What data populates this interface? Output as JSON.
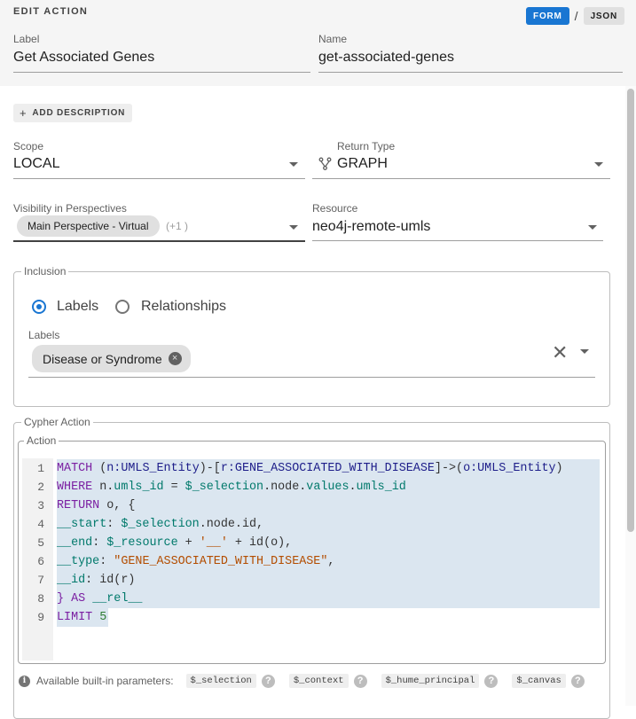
{
  "header": {
    "title": "EDIT ACTION",
    "mode_form": "FORM",
    "mode_sep": "/",
    "mode_json": "JSON"
  },
  "label_field": {
    "label": "Label",
    "value": "Get Associated Genes"
  },
  "name_field": {
    "label": "Name",
    "value": "get-associated-genes"
  },
  "add_description": {
    "plus": "+",
    "label": "ADD DESCRIPTION"
  },
  "scope": {
    "label": "Scope",
    "value": "LOCAL"
  },
  "return_type": {
    "label": "Return Type",
    "value": "GRAPH",
    "icon": "graph-branch-icon"
  },
  "visibility": {
    "label": "Visibility in Perspectives",
    "chip": "Main Perspective - Virtual",
    "more": "(+1 )"
  },
  "resource": {
    "label": "Resource",
    "value": "neo4j-remote-umls"
  },
  "inclusion": {
    "legend": "Inclusion",
    "radio_labels": "Labels",
    "radio_relationships": "Relationships",
    "selected": "Labels",
    "labels_field_label": "Labels",
    "labels_chip": "Disease or Syndrome",
    "chip_remove": "×",
    "clear": "✕"
  },
  "cypher": {
    "legend": "Cypher Action",
    "action_legend": "Action",
    "lines": [
      [
        {
          "c": "k",
          "t": "MATCH "
        },
        {
          "c": "p",
          "t": "("
        },
        {
          "c": "t",
          "t": "n:UMLS_Entity"
        },
        {
          "c": "p",
          "t": ")-["
        },
        {
          "c": "t",
          "t": "r:GENE_ASSOCIATED_WITH_DISEASE"
        },
        {
          "c": "p",
          "t": "]->("
        },
        {
          "c": "t",
          "t": "o:UMLS_Entity"
        },
        {
          "c": "p",
          "t": ")"
        }
      ],
      [
        {
          "c": "k",
          "t": "WHERE "
        },
        {
          "c": "p",
          "t": "n."
        },
        {
          "c": "v",
          "t": "umls_id"
        },
        {
          "c": "p",
          "t": " = "
        },
        {
          "c": "v",
          "t": "$_selection"
        },
        {
          "c": "p",
          "t": ".node."
        },
        {
          "c": "v",
          "t": "values"
        },
        {
          "c": "p",
          "t": "."
        },
        {
          "c": "v",
          "t": "umls_id"
        }
      ],
      [
        {
          "c": "k",
          "t": "RETURN "
        },
        {
          "c": "p",
          "t": "o, {"
        }
      ],
      [
        {
          "c": "v",
          "t": "__start"
        },
        {
          "c": "p",
          "t": ": "
        },
        {
          "c": "v",
          "t": "$_selection"
        },
        {
          "c": "p",
          "t": ".node.id,"
        }
      ],
      [
        {
          "c": "v",
          "t": "__end"
        },
        {
          "c": "p",
          "t": ": "
        },
        {
          "c": "v",
          "t": "$_resource"
        },
        {
          "c": "p",
          "t": " + "
        },
        {
          "c": "s",
          "t": "'__'"
        },
        {
          "c": "p",
          "t": " + id(o),"
        }
      ],
      [
        {
          "c": "v",
          "t": "__type"
        },
        {
          "c": "p",
          "t": ": "
        },
        {
          "c": "s",
          "t": "\"GENE_ASSOCIATED_WITH_DISEASE\""
        },
        {
          "c": "p",
          "t": ","
        }
      ],
      [
        {
          "c": "v",
          "t": "__id"
        },
        {
          "c": "p",
          "t": ": id(r)"
        }
      ],
      [
        {
          "c": "k",
          "t": "} AS "
        },
        {
          "c": "v",
          "t": "__rel__"
        }
      ],
      [
        {
          "c": "k",
          "t": "LIMIT "
        },
        {
          "c": "num",
          "t": "5"
        }
      ]
    ]
  },
  "params": {
    "label": "Available built-in parameters:",
    "items": [
      "$_selection",
      "$_context",
      "$_hume_principal",
      "$_canvas"
    ],
    "help": "?",
    "info": "i"
  },
  "colors": {
    "accent": "#1976d2",
    "code_highlight": "#dbe6f0"
  }
}
